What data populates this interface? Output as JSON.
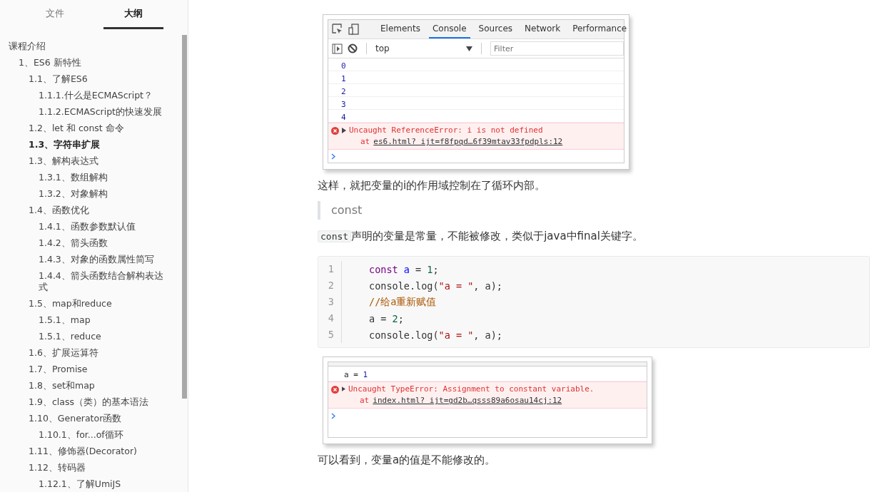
{
  "sidebar": {
    "tabs": [
      {
        "label": "文件",
        "selected": false
      },
      {
        "label": "大纲",
        "selected": true
      }
    ],
    "outline": [
      {
        "label": "课程介绍",
        "active": false,
        "children": [
          {
            "label": "1、ES6 新特性",
            "active": false,
            "children": [
              {
                "label": "1.1、了解ES6",
                "active": false,
                "children": [
                  {
                    "label": "1.1.1.什么是ECMAScript？",
                    "active": false
                  },
                  {
                    "label": "1.1.2.ECMAScript的快速发展",
                    "active": false
                  }
                ]
              },
              {
                "label": "1.2、let 和 const 命令",
                "active": false
              },
              {
                "label": "1.3、字符串扩展",
                "active": true
              },
              {
                "label": "1.3、解构表达式",
                "active": false,
                "children": [
                  {
                    "label": "1.3.1、数组解构",
                    "active": false
                  },
                  {
                    "label": "1.3.2、对象解构",
                    "active": false
                  }
                ]
              },
              {
                "label": "1.4、函数优化",
                "active": false,
                "children": [
                  {
                    "label": "1.4.1、函数参数默认值",
                    "active": false
                  },
                  {
                    "label": "1.4.2、箭头函数",
                    "active": false
                  },
                  {
                    "label": "1.4.3、对象的函数属性简写",
                    "active": false
                  },
                  {
                    "label": "1.4.4、箭头函数结合解构表达式",
                    "active": false
                  }
                ]
              },
              {
                "label": "1.5、map和reduce",
                "active": false,
                "children": [
                  {
                    "label": "1.5.1、map",
                    "active": false
                  },
                  {
                    "label": "1.5.1、reduce",
                    "active": false
                  }
                ]
              },
              {
                "label": "1.6、扩展运算符",
                "active": false
              },
              {
                "label": "1.7、Promise",
                "active": false
              },
              {
                "label": "1.8、set和map",
                "active": false
              },
              {
                "label": "1.9、class（类）的基本语法",
                "active": false
              },
              {
                "label": "1.10、Generator函数",
                "active": false,
                "children": [
                  {
                    "label": "1.10.1、for...of循环",
                    "active": false
                  }
                ]
              },
              {
                "label": "1.11、修饰器(Decorator)",
                "active": false
              },
              {
                "label": "1.12、转码器",
                "active": false,
                "children": [
                  {
                    "label": "1.12.1、了解UmiJS",
                    "active": false
                  }
                ]
              }
            ]
          }
        ]
      }
    ]
  },
  "content": [
    {
      "kind": "console",
      "tabs": [
        {
          "label": "Elements",
          "selected": false
        },
        {
          "label": "Console",
          "selected": true
        },
        {
          "label": "Sources",
          "selected": false
        },
        {
          "label": "Network",
          "selected": false
        },
        {
          "label": "Performance",
          "selected": false
        }
      ],
      "context": "top",
      "filter_placeholder": "Filter",
      "lines": [
        {
          "kind": "log",
          "parts": [
            {
              "kind": "number",
              "text": "0"
            }
          ]
        },
        {
          "kind": "log",
          "parts": [
            {
              "kind": "number",
              "text": "1"
            }
          ]
        },
        {
          "kind": "log",
          "parts": [
            {
              "kind": "number",
              "text": "2"
            }
          ]
        },
        {
          "kind": "log",
          "parts": [
            {
              "kind": "number",
              "text": "3"
            }
          ]
        },
        {
          "kind": "log",
          "parts": [
            {
              "kind": "number",
              "text": "4"
            }
          ]
        },
        {
          "kind": "error",
          "message": "Uncaught ReferenceError: i is not defined",
          "at": "at",
          "link": "es6.html? ijt=f8fpqd…6f39mtav33fpdpls:12"
        }
      ]
    },
    {
      "kind": "paragraph",
      "text": "这样，就把变量的i的作用域控制在了循环内部。"
    },
    {
      "kind": "quote",
      "text": "const"
    },
    {
      "kind": "paragraph",
      "code": "const",
      "text": "声明的变量是常量，不能被修改，类似于java中final关键字。"
    },
    {
      "kind": "code",
      "lines": [
        {
          "number": "1",
          "tokens": [
            {
              "kind": "keyword",
              "text": "const "
            },
            {
              "kind": "variable",
              "text": "a"
            },
            {
              "kind": "plain",
              "text": " = "
            },
            {
              "kind": "number",
              "text": "1"
            },
            {
              "kind": "plain",
              "text": ";"
            }
          ]
        },
        {
          "number": "2",
          "tokens": [
            {
              "kind": "plain",
              "text": "console.log("
            },
            {
              "kind": "string",
              "text": "\"a = \""
            },
            {
              "kind": "plain",
              "text": ", a);"
            }
          ]
        },
        {
          "number": "3",
          "tokens": [
            {
              "kind": "comment",
              "text": "//给a重新赋值"
            }
          ]
        },
        {
          "number": "4",
          "tokens": [
            {
              "kind": "plain",
              "text": "a = "
            },
            {
              "kind": "number",
              "text": "2"
            },
            {
              "kind": "plain",
              "text": ";"
            }
          ]
        },
        {
          "number": "5",
          "tokens": [
            {
              "kind": "plain",
              "text": "console.log("
            },
            {
              "kind": "string",
              "text": "\"a = \""
            },
            {
              "kind": "plain",
              "text": ", a);"
            }
          ]
        }
      ]
    },
    {
      "kind": "console_cropped",
      "lines": [
        {
          "kind": "log",
          "parts": [
            {
              "kind": "plain",
              "text": "a = "
            },
            {
              "kind": "number",
              "text": "1"
            }
          ]
        },
        {
          "kind": "error",
          "message": "Uncaught TypeError: Assignment to constant variable.",
          "at": "at",
          "link": "index.html? ijt=gd2b…qsss89a6osau14cj:12"
        }
      ]
    },
    {
      "kind": "paragraph",
      "text": "可以看到，变量a的值是不能修改的。"
    }
  ]
}
